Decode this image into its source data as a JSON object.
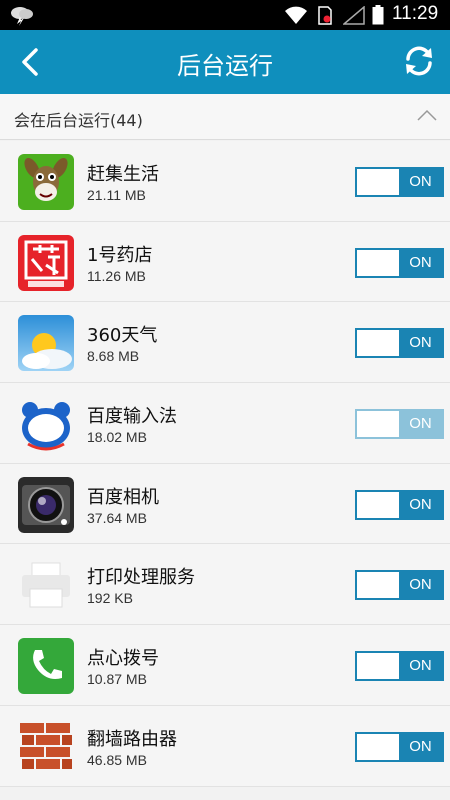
{
  "status_bar": {
    "time": "11:29",
    "icons": [
      "weather-icon",
      "wifi-icon",
      "sim-icon",
      "signal-icon",
      "battery-icon"
    ]
  },
  "header": {
    "title": "后台运行",
    "back_icon": "back-arrow-icon",
    "refresh_icon": "refresh-icon"
  },
  "section": {
    "label": "会在后台运行(44)",
    "toggle_icon": "chevron-up-icon"
  },
  "apps": [
    {
      "name": "赶集生活",
      "size": "21.11 MB",
      "toggle": "ON",
      "enabled": true,
      "icon": "donkey-icon"
    },
    {
      "name": "1号药店",
      "size": "11.26 MB",
      "toggle": "ON",
      "enabled": true,
      "icon": "pharmacy-icon"
    },
    {
      "name": "360天气",
      "size": "8.68 MB",
      "toggle": "ON",
      "enabled": true,
      "icon": "weather-app-icon"
    },
    {
      "name": "百度输入法",
      "size": "18.02 MB",
      "toggle": "ON",
      "enabled": false,
      "icon": "baidu-input-icon"
    },
    {
      "name": "百度相机",
      "size": "37.64 MB",
      "toggle": "ON",
      "enabled": true,
      "icon": "camera-icon"
    },
    {
      "name": "打印处理服务",
      "size": "192 KB",
      "toggle": "ON",
      "enabled": true,
      "icon": "printer-icon"
    },
    {
      "name": "点心拨号",
      "size": "10.87 MB",
      "toggle": "ON",
      "enabled": true,
      "icon": "phone-dialer-icon"
    },
    {
      "name": "翻墙路由器",
      "size": "46.85 MB",
      "toggle": "ON",
      "enabled": true,
      "icon": "brick-wall-icon"
    }
  ],
  "colors": {
    "accent": "#0f8fbd",
    "toggle_on": "#1a84b3",
    "toggle_dim": "#8cc2da",
    "background": "#f5f5f5"
  }
}
